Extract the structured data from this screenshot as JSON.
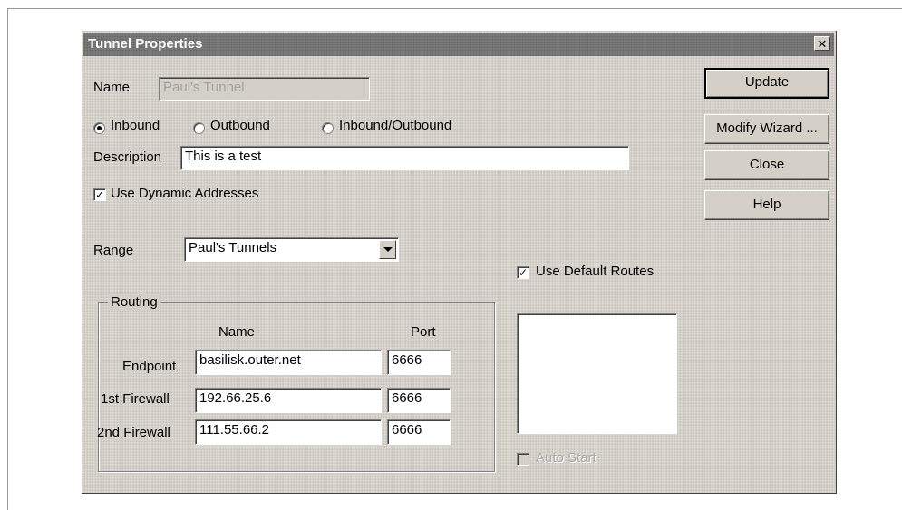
{
  "window": {
    "title": "Tunnel Properties",
    "close_glyph": "✕"
  },
  "name_label": "Name",
  "name_value": "Paul's Tunnel",
  "direction": {
    "options": [
      "Inbound",
      "Outbound",
      "Inbound/Outbound"
    ],
    "selected": "Inbound"
  },
  "description_label": "Description",
  "description_value": "This is a test",
  "dynamic_addresses": {
    "label": "Use Dynamic Addresses",
    "checked": true
  },
  "range": {
    "label": "Range",
    "value": "Paul's Tunnels"
  },
  "default_routes": {
    "label": "Use Default Routes",
    "checked": true
  },
  "routing": {
    "group_label": "Routing",
    "col_name": "Name",
    "col_port": "Port",
    "rows": [
      {
        "label": "Endpoint",
        "name": "basilisk.outer.net",
        "port": "6666"
      },
      {
        "label": "1st Firewall",
        "name": "192.66.25.6",
        "port": "6666"
      },
      {
        "label": "2nd Firewall",
        "name": "111.55.66.2",
        "port": "6666"
      }
    ]
  },
  "auto_start": {
    "label": "Auto Start",
    "checked": false,
    "enabled": false
  },
  "buttons": {
    "update": "Update",
    "modify_wizard": "Modify Wizard ...",
    "close": "Close",
    "help": "Help"
  },
  "icons": {
    "check_mark": "✓",
    "dropdown": "chevron-down-icon"
  },
  "colors": {
    "dialog_face": "#d4d0c8",
    "titlebar": "#7a7a7a"
  }
}
